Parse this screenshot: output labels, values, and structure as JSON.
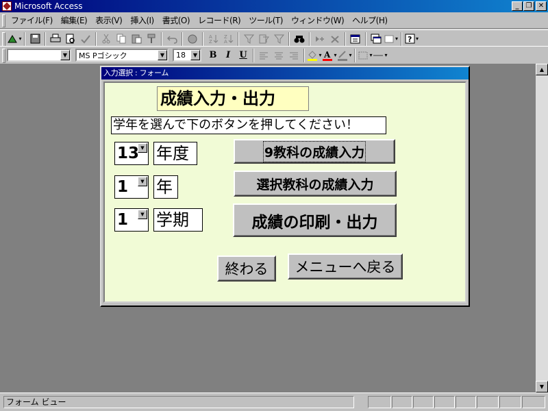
{
  "window": {
    "title": "Microsoft Access",
    "controls": {
      "minimize": "_",
      "maximize": "❐",
      "close": "✕"
    }
  },
  "menu": [
    {
      "label": "ファイル(F)"
    },
    {
      "label": "編集(E)"
    },
    {
      "label": "表示(V)"
    },
    {
      "label": "挿入(I)"
    },
    {
      "label": "書式(O)"
    },
    {
      "label": "レコード(R)"
    },
    {
      "label": "ツール(T)"
    },
    {
      "label": "ウィンドウ(W)"
    },
    {
      "label": "ヘルプ(H)"
    }
  ],
  "toolbar_format": {
    "object_combo": "",
    "font_name": "MS Pゴシック",
    "font_size": "18",
    "bold_label": "B",
    "italic_label": "I",
    "underline_label": "U",
    "font_color_label": "A",
    "accent_colors": {
      "font_color": "#ff0000",
      "fill_color": "#ffff00"
    }
  },
  "form": {
    "window_title": "入力選択 : フォーム",
    "heading": "成績入力・出力",
    "instruction": "学年を選んで下のボタンを押してください！",
    "rows": [
      {
        "value": "13",
        "label": "年度"
      },
      {
        "value": "1",
        "label": "年"
      },
      {
        "value": "1",
        "label": "学期"
      }
    ],
    "buttons": {
      "nine_subjects": "9教科の成績入力",
      "selected_subject": "選択教科の成績入力",
      "print_output": "成績の印刷・出力",
      "finish": "終わる",
      "back_to_menu": "メニューへ戻る"
    },
    "background_color": "#f1fbd6",
    "heading_color": "#ffffc0"
  },
  "status": {
    "text": "フォーム ビュー"
  }
}
